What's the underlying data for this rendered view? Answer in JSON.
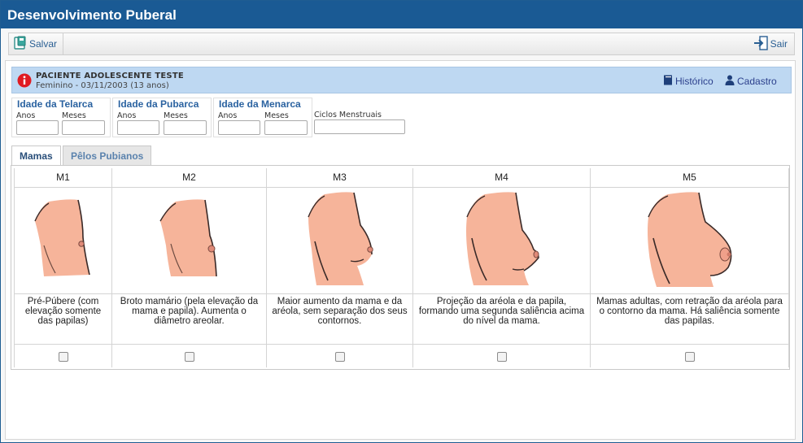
{
  "window": {
    "title": "Desenvolvimento Puberal"
  },
  "toolbar": {
    "save_label": "Salvar",
    "exit_label": "Sair"
  },
  "patient": {
    "name": "PACIENTE ADOLESCENTE TESTE",
    "details": "Feminino - 03/11/2003 (13 anos)",
    "history_label": "Histórico",
    "register_label": "Cadastro"
  },
  "ages": {
    "telarca": {
      "title": "Idade da Telarca",
      "years_label": "Anos",
      "months_label": "Meses",
      "years_value": "",
      "months_value": ""
    },
    "pubarca": {
      "title": "Idade da Pubarca",
      "years_label": "Anos",
      "months_label": "Meses",
      "years_value": "",
      "months_value": ""
    },
    "menarca": {
      "title": "Idade da Menarca",
      "years_label": "Anos",
      "months_label": "Meses",
      "years_value": "",
      "months_value": ""
    },
    "cycles": {
      "label": "Ciclos Menstruais",
      "value": ""
    }
  },
  "tabs": [
    {
      "label": "Mamas",
      "active": true
    },
    {
      "label": "Pêlos Pubianos",
      "active": false
    }
  ],
  "stages": [
    {
      "label": "M1",
      "description": "Pré-Púbere (com elevação somente das papilas)",
      "checked": false
    },
    {
      "label": "M2",
      "description": "Broto mamário (pela elevação da mama e papila). Aumenta o diâmetro areolar.",
      "checked": false
    },
    {
      "label": "M3",
      "description": "Maior aumento da mama e da aréola, sem separação dos seus contornos.",
      "checked": false
    },
    {
      "label": "M4",
      "description": "Projeção da aréola e da papila, formando uma segunda saliência acima do nível da mama.",
      "checked": false
    },
    {
      "label": "M5",
      "description": "Mamas adultas, com retração da aréola para o contorno da mama. Há saliência somente das papilas.",
      "checked": false
    }
  ],
  "colors": {
    "titlebar": "#1a5a94",
    "patient_bar": "#bed8f2",
    "accent_text": "#2a62a0",
    "skin": "#f6b49a",
    "skin_outline": "#3a2a28",
    "alert": "#e01b22"
  },
  "icons": {
    "save": "save-icon",
    "exit": "exit-icon",
    "alert": "info-alert-icon",
    "history": "book-icon",
    "register": "user-icon"
  }
}
